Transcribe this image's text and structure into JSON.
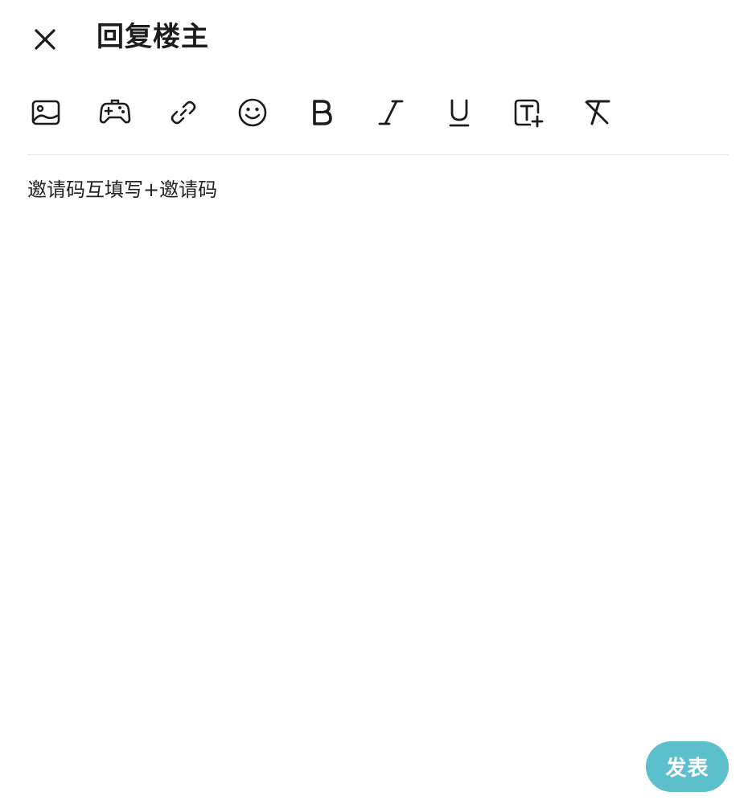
{
  "header": {
    "title": "回复楼主",
    "close_icon": "close-icon"
  },
  "toolbar": {
    "items": [
      {
        "name": "image",
        "icon": "image-icon"
      },
      {
        "name": "game",
        "icon": "gamepad-icon"
      },
      {
        "name": "link",
        "icon": "link-icon"
      },
      {
        "name": "emoji",
        "icon": "smiley-icon"
      },
      {
        "name": "bold",
        "icon": "bold-icon"
      },
      {
        "name": "italic",
        "icon": "italic-icon"
      },
      {
        "name": "underline",
        "icon": "underline-icon"
      },
      {
        "name": "text-size",
        "icon": "text-add-icon"
      },
      {
        "name": "clear-format",
        "icon": "clear-format-icon"
      }
    ]
  },
  "editor": {
    "value": "邀请码互填写+邀请码"
  },
  "actions": {
    "submit_label": "发表"
  },
  "colors": {
    "accent": "#5bbfcc",
    "text": "#1f1f1f",
    "divider": "#e7e7e7"
  }
}
